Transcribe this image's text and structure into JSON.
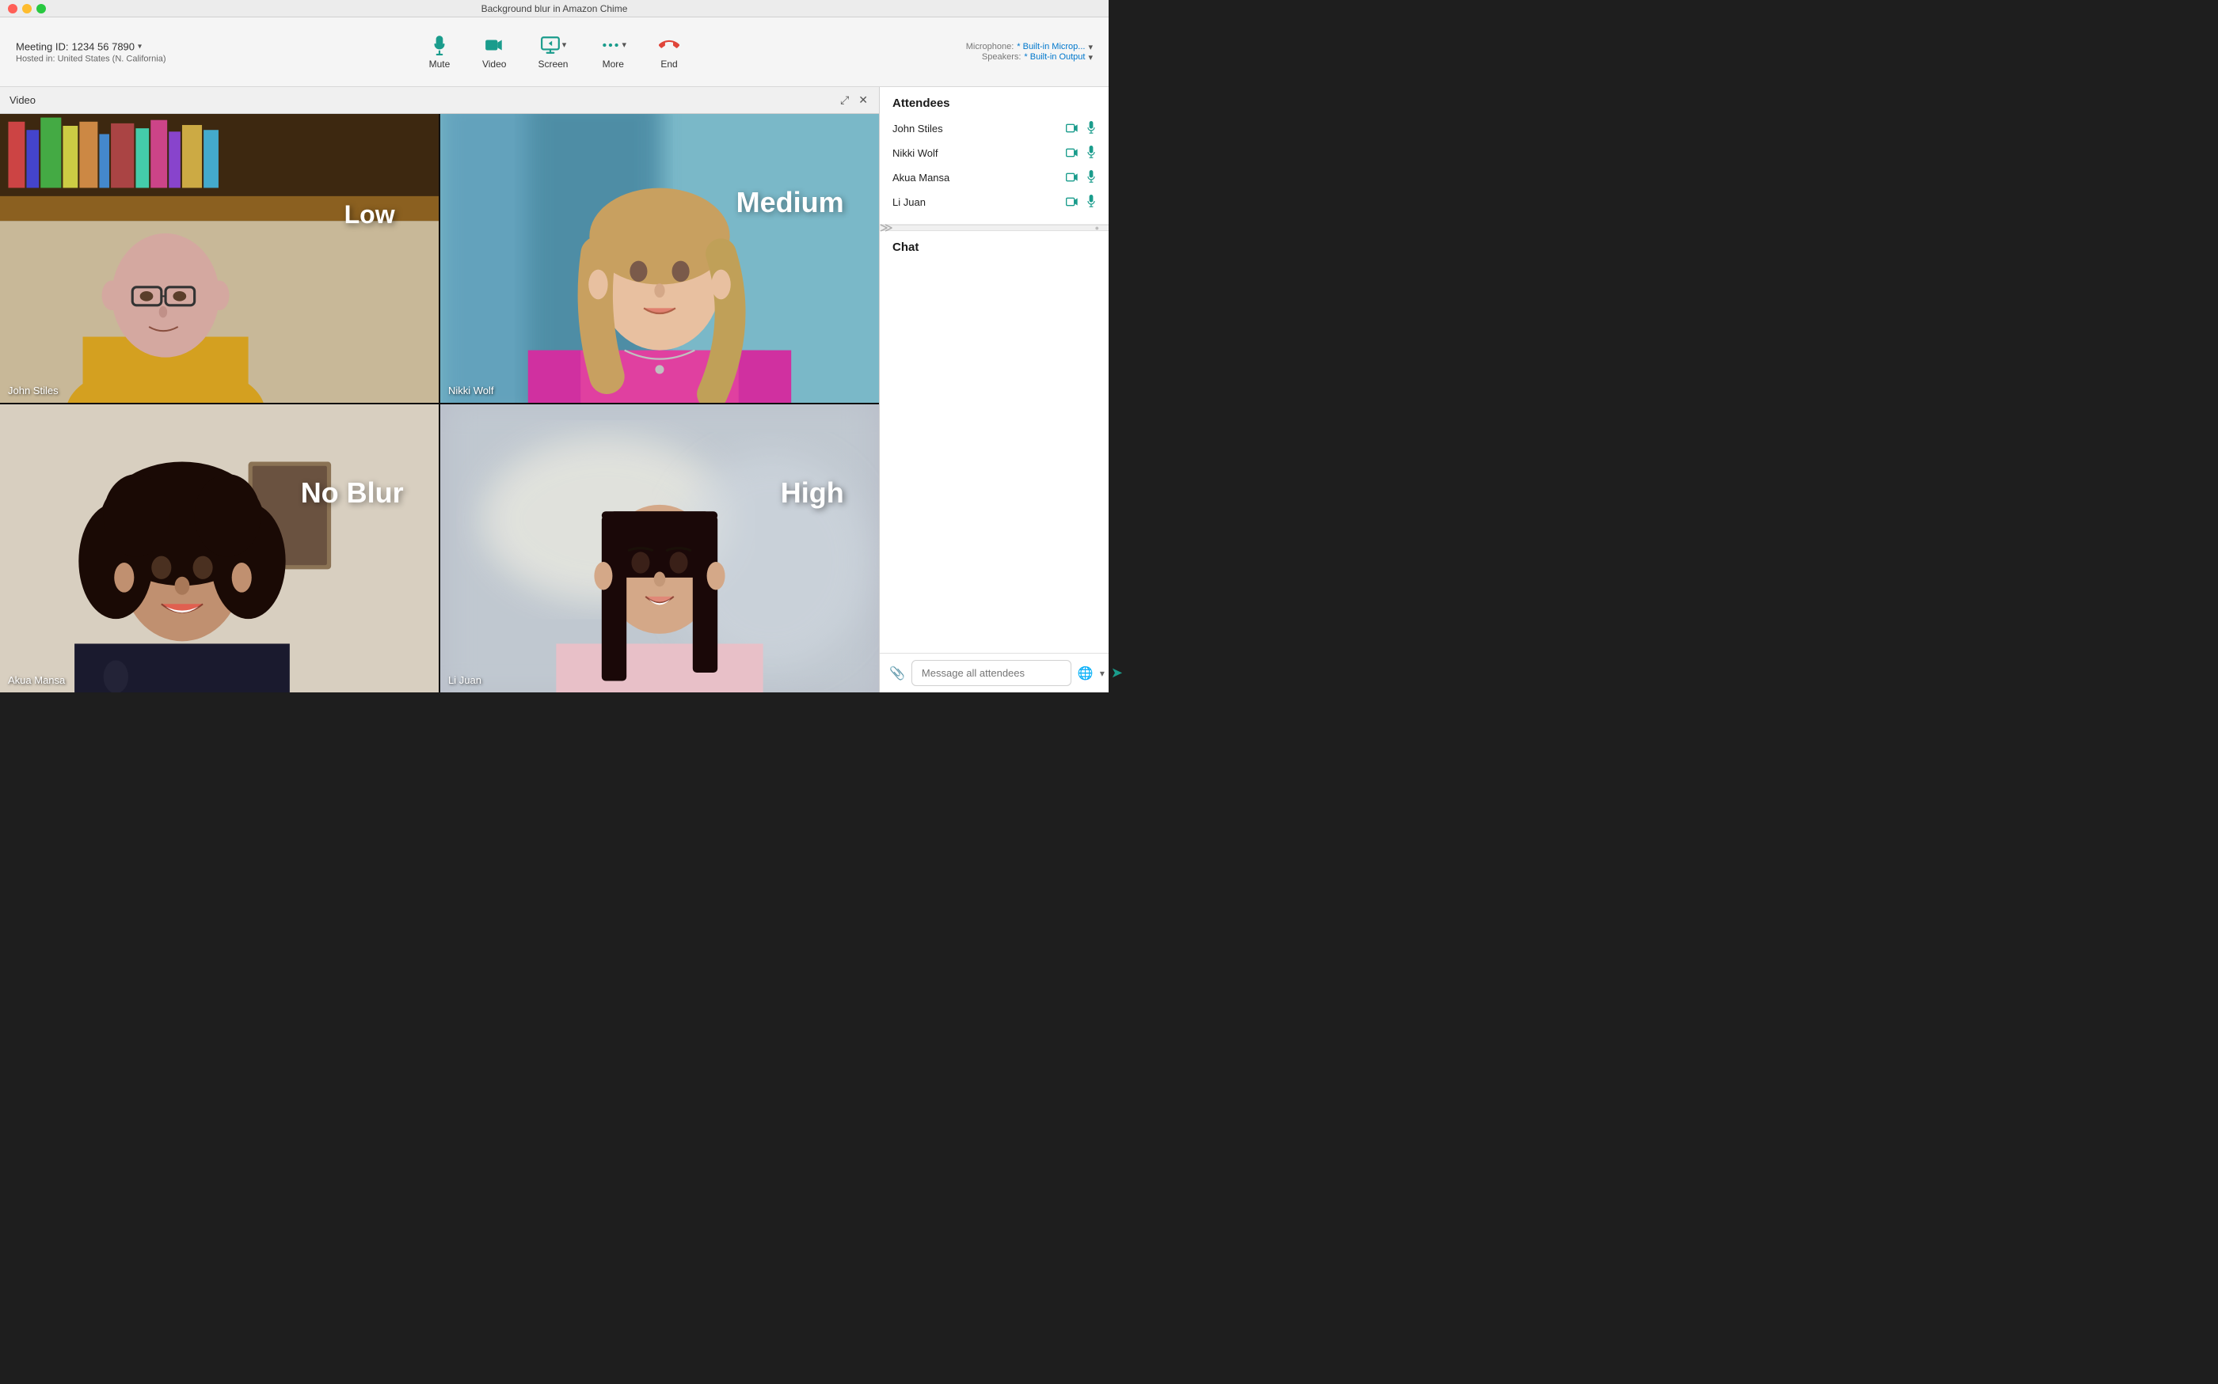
{
  "titlebar": {
    "title": "Background blur in Amazon Chime"
  },
  "meeting": {
    "id_label": "Meeting ID:",
    "id_value": "1234 56 7890",
    "hosted_label": "Hosted in: United States (N. California)"
  },
  "toolbar": {
    "buttons": [
      {
        "id": "mute",
        "label": "Mute",
        "icon": "🎙"
      },
      {
        "id": "video",
        "label": "Video",
        "icon": "📷"
      },
      {
        "id": "screen",
        "label": "Screen",
        "icon": "🖥",
        "has_arrow": true
      },
      {
        "id": "more",
        "label": "More",
        "icon": "•••",
        "has_arrow": true
      },
      {
        "id": "end",
        "label": "End",
        "icon": "📞"
      }
    ],
    "devices": {
      "microphone_label": "Microphone:",
      "microphone_value": "* Built-in Microp...",
      "speakers_label": "Speakers:",
      "speakers_value": "* Built-in Output"
    }
  },
  "video_panel": {
    "title": "Video"
  },
  "video_tiles": [
    {
      "id": "john",
      "name": "John Stiles",
      "blur_label": "Low",
      "active": false
    },
    {
      "id": "nikki",
      "name": "Nikki Wolf",
      "blur_label": "Medium",
      "active": true
    },
    {
      "id": "akua",
      "name": "Akua Mansa",
      "blur_label": "No Blur",
      "active": false
    },
    {
      "id": "lijuan",
      "name": "Li Juan",
      "blur_label": "High",
      "active": false
    }
  ],
  "attendees": {
    "title": "Attendees",
    "list": [
      {
        "name": "John Stiles"
      },
      {
        "name": "Nikki Wolf"
      },
      {
        "name": "Akua Mansa"
      },
      {
        "name": "Li Juan"
      }
    ]
  },
  "chat": {
    "title": "Chat",
    "input_placeholder": "Message all attendees"
  }
}
